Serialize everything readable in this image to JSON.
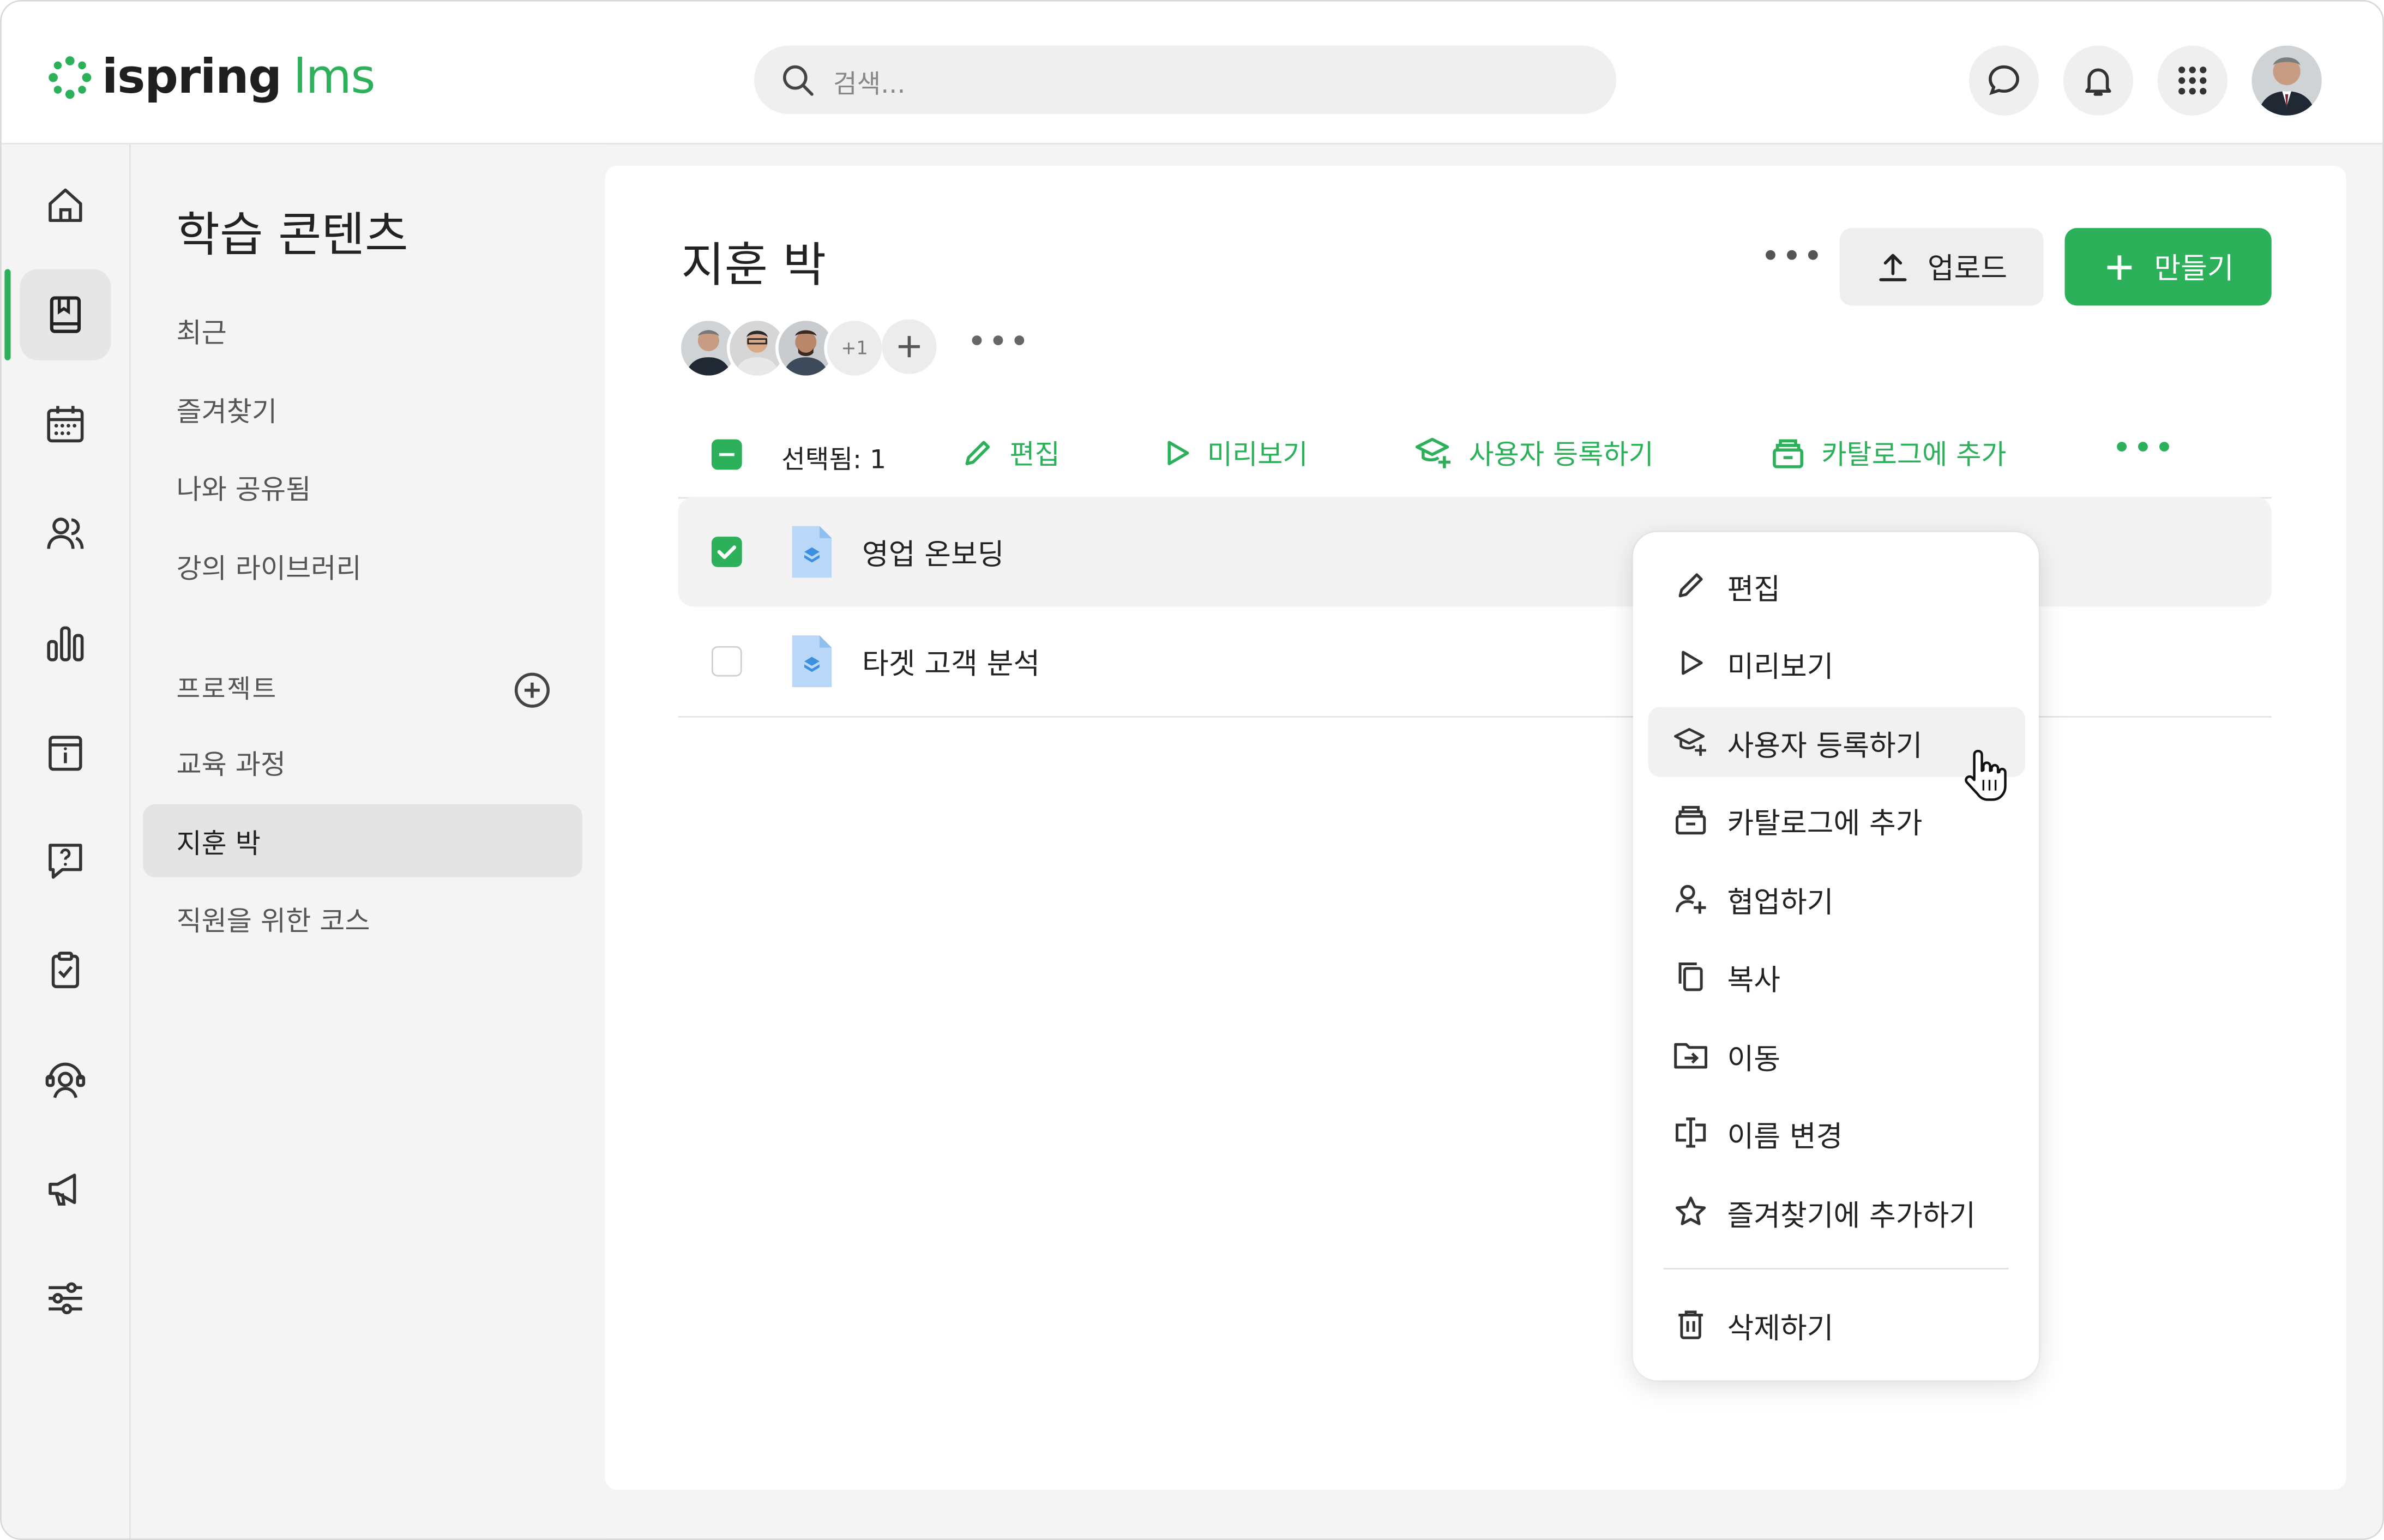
{
  "app": {
    "logo_part1": "ispring",
    "logo_part2": "lms",
    "brand_color": "#2db05a"
  },
  "search": {
    "placeholder": "검색..."
  },
  "header_icons": [
    "chat-icon",
    "bell-icon",
    "apps-grid-icon",
    "user-avatar"
  ],
  "rail": {
    "items": [
      "home-icon",
      "content-book-icon",
      "calendar-icon",
      "users-icon",
      "reports-chart-icon",
      "info-card-icon",
      "question-chat-icon",
      "clipboard-check-icon",
      "support-agent-icon",
      "megaphone-icon",
      "settings-sliders-icon"
    ],
    "active_index": 1
  },
  "subnav": {
    "title": "학습 콘텐츠",
    "items": [
      "최근",
      "즐겨찾기",
      "나와 공유됨",
      "강의 라이브러리"
    ],
    "projects_label": "프로젝트",
    "projects": [
      "교육 과정",
      "지훈 박",
      "직원을 위한 코스"
    ],
    "active_project": "지훈 박"
  },
  "main": {
    "title": "지훈 박",
    "members_extra": "+1",
    "upload_label": "업로드",
    "create_label": "만들기"
  },
  "toolbar": {
    "selected_label": "선택됨: 1",
    "edit": "편집",
    "preview": "미리보기",
    "enroll": "사용자 등록하기",
    "add_catalog": "카탈로그에 추가"
  },
  "rows": [
    {
      "name": "영업 온보딩",
      "checked": true
    },
    {
      "name": "타겟 고객 분석",
      "checked": false
    }
  ],
  "context_menu": {
    "items": [
      "편집",
      "미리보기",
      "사용자 등록하기",
      "카탈로그에 추가",
      "협업하기",
      "복사",
      "이동",
      "이름 변경",
      "즐겨찾기에 추가하기"
    ],
    "delete": "삭제하기",
    "hovered": "사용자 등록하기"
  }
}
